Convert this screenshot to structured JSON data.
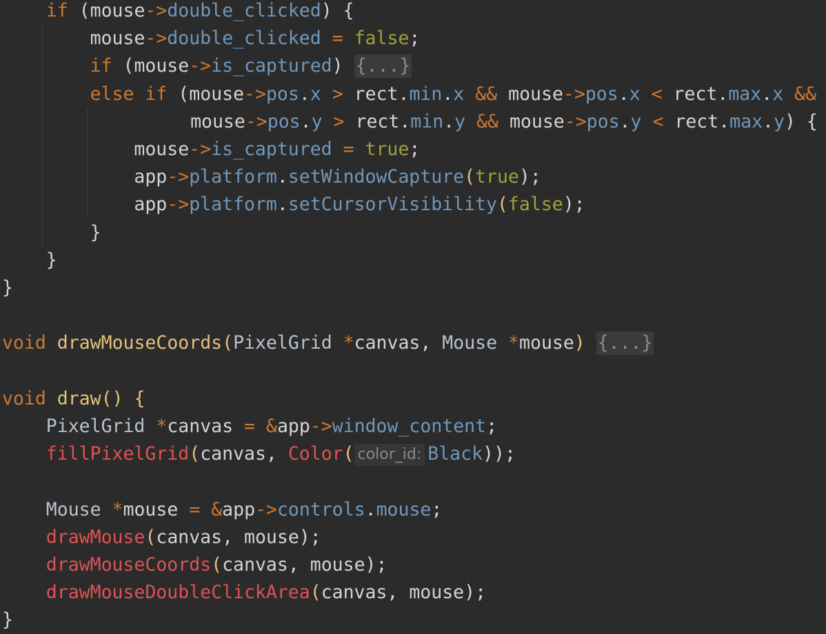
{
  "editor": {
    "colors": {
      "background": "#2b2b2b",
      "keyword": "#cc7832",
      "identifier": "#d4d4d4",
      "field": "#6f98bc",
      "literal": "#a0a03a",
      "method": "#6f98bc",
      "function_decl": "#e6c07b",
      "function_call": "#e05252",
      "type": "#b9c2cc",
      "fold_text": "#8c8c8c",
      "hint_text": "#8a8a8a"
    },
    "lines": [
      {
        "indent": 1,
        "tokens": [
          {
            "t": "if",
            "k": "kw"
          },
          {
            "t": " (",
            "k": "p"
          },
          {
            "t": "mouse",
            "k": "id"
          },
          {
            "t": "->",
            "k": "op"
          },
          {
            "t": "double_clicked",
            "k": "fd"
          },
          {
            "t": ") {",
            "k": "p"
          }
        ]
      },
      {
        "indent": 2,
        "tokens": [
          {
            "t": "mouse",
            "k": "id"
          },
          {
            "t": "->",
            "k": "op"
          },
          {
            "t": "double_clicked",
            "k": "fd"
          },
          {
            "t": " ",
            "k": "p"
          },
          {
            "t": "=",
            "k": "op"
          },
          {
            "t": " ",
            "k": "p"
          },
          {
            "t": "false",
            "k": "lit"
          },
          {
            "t": ";",
            "k": "p"
          }
        ]
      },
      {
        "indent": 2,
        "tokens": [
          {
            "t": "if",
            "k": "kw"
          },
          {
            "t": " (",
            "k": "p"
          },
          {
            "t": "mouse",
            "k": "id"
          },
          {
            "t": "->",
            "k": "op"
          },
          {
            "t": "is_captured",
            "k": "fd"
          },
          {
            "t": ") ",
            "k": "p"
          },
          {
            "t": "{...}",
            "k": "fold"
          }
        ]
      },
      {
        "indent": 2,
        "tokens": [
          {
            "t": "else",
            "k": "kw"
          },
          {
            "t": " ",
            "k": "p"
          },
          {
            "t": "if",
            "k": "kw"
          },
          {
            "t": " (",
            "k": "p"
          },
          {
            "t": "mouse",
            "k": "id"
          },
          {
            "t": "->",
            "k": "op"
          },
          {
            "t": "pos",
            "k": "fd"
          },
          {
            "t": ".",
            "k": "p"
          },
          {
            "t": "x",
            "k": "fd"
          },
          {
            "t": " ",
            "k": "p"
          },
          {
            "t": ">",
            "k": "op"
          },
          {
            "t": " ",
            "k": "p"
          },
          {
            "t": "rect",
            "k": "id"
          },
          {
            "t": ".",
            "k": "p"
          },
          {
            "t": "min",
            "k": "fd"
          },
          {
            "t": ".",
            "k": "p"
          },
          {
            "t": "x",
            "k": "fd"
          },
          {
            "t": " ",
            "k": "p"
          },
          {
            "t": "&&",
            "k": "op"
          },
          {
            "t": " ",
            "k": "p"
          },
          {
            "t": "mouse",
            "k": "id"
          },
          {
            "t": "->",
            "k": "op"
          },
          {
            "t": "pos",
            "k": "fd"
          },
          {
            "t": ".",
            "k": "p"
          },
          {
            "t": "x",
            "k": "fd"
          },
          {
            "t": " ",
            "k": "p"
          },
          {
            "t": "<",
            "k": "op"
          },
          {
            "t": " ",
            "k": "p"
          },
          {
            "t": "rect",
            "k": "id"
          },
          {
            "t": ".",
            "k": "p"
          },
          {
            "t": "max",
            "k": "fd"
          },
          {
            "t": ".",
            "k": "p"
          },
          {
            "t": "x",
            "k": "fd"
          },
          {
            "t": " ",
            "k": "p"
          },
          {
            "t": "&&",
            "k": "op"
          }
        ]
      },
      {
        "indent": 4.28,
        "tokens": [
          {
            "t": "mouse",
            "k": "id"
          },
          {
            "t": "->",
            "k": "op"
          },
          {
            "t": "pos",
            "k": "fd"
          },
          {
            "t": ".",
            "k": "p"
          },
          {
            "t": "y",
            "k": "fd"
          },
          {
            "t": " ",
            "k": "p"
          },
          {
            "t": ">",
            "k": "op"
          },
          {
            "t": " ",
            "k": "p"
          },
          {
            "t": "rect",
            "k": "id"
          },
          {
            "t": ".",
            "k": "p"
          },
          {
            "t": "min",
            "k": "fd"
          },
          {
            "t": ".",
            "k": "p"
          },
          {
            "t": "y",
            "k": "fd"
          },
          {
            "t": " ",
            "k": "p"
          },
          {
            "t": "&&",
            "k": "op"
          },
          {
            "t": " ",
            "k": "p"
          },
          {
            "t": "mouse",
            "k": "id"
          },
          {
            "t": "->",
            "k": "op"
          },
          {
            "t": "pos",
            "k": "fd"
          },
          {
            "t": ".",
            "k": "p"
          },
          {
            "t": "y",
            "k": "fd"
          },
          {
            "t": " ",
            "k": "p"
          },
          {
            "t": "<",
            "k": "op"
          },
          {
            "t": " ",
            "k": "p"
          },
          {
            "t": "rect",
            "k": "id"
          },
          {
            "t": ".",
            "k": "p"
          },
          {
            "t": "max",
            "k": "fd"
          },
          {
            "t": ".",
            "k": "p"
          },
          {
            "t": "y",
            "k": "fd"
          },
          {
            "t": ") {",
            "k": "p"
          }
        ]
      },
      {
        "indent": 3,
        "tokens": [
          {
            "t": "mouse",
            "k": "id"
          },
          {
            "t": "->",
            "k": "op"
          },
          {
            "t": "is_captured",
            "k": "fd"
          },
          {
            "t": " ",
            "k": "p"
          },
          {
            "t": "=",
            "k": "op"
          },
          {
            "t": " ",
            "k": "p"
          },
          {
            "t": "true",
            "k": "lit"
          },
          {
            "t": ";",
            "k": "p"
          }
        ]
      },
      {
        "indent": 3,
        "tokens": [
          {
            "t": "app",
            "k": "id"
          },
          {
            "t": "->",
            "k": "op"
          },
          {
            "t": "platform",
            "k": "fd"
          },
          {
            "t": ".",
            "k": "p"
          },
          {
            "t": "setWindowCapture",
            "k": "mt"
          },
          {
            "t": "(",
            "k": "pp"
          },
          {
            "t": "true",
            "k": "lit"
          },
          {
            "t": ");",
            "k": "p"
          }
        ]
      },
      {
        "indent": 3,
        "tokens": [
          {
            "t": "app",
            "k": "id"
          },
          {
            "t": "->",
            "k": "op"
          },
          {
            "t": "platform",
            "k": "fd"
          },
          {
            "t": ".",
            "k": "p"
          },
          {
            "t": "setCursorVisibility",
            "k": "mt"
          },
          {
            "t": "(",
            "k": "pp"
          },
          {
            "t": "false",
            "k": "lit"
          },
          {
            "t": ");",
            "k": "p"
          }
        ]
      },
      {
        "indent": 2,
        "tokens": [
          {
            "t": "}",
            "k": "p"
          }
        ]
      },
      {
        "indent": 1,
        "tokens": [
          {
            "t": "}",
            "k": "p"
          }
        ]
      },
      {
        "indent": 0,
        "tokens": [
          {
            "t": "}",
            "k": "p"
          }
        ]
      },
      {
        "indent": 0,
        "tokens": []
      },
      {
        "indent": 0,
        "tokens": [
          {
            "t": "void",
            "k": "kw"
          },
          {
            "t": " ",
            "k": "p"
          },
          {
            "t": "drawMouseCoords",
            "k": "fn"
          },
          {
            "t": "(",
            "k": "pp"
          },
          {
            "t": "PixelGrid",
            "k": "ty"
          },
          {
            "t": " ",
            "k": "p"
          },
          {
            "t": "*",
            "k": "op"
          },
          {
            "t": "canvas",
            "k": "id"
          },
          {
            "t": ", ",
            "k": "p"
          },
          {
            "t": "Mouse",
            "k": "ty"
          },
          {
            "t": " ",
            "k": "p"
          },
          {
            "t": "*",
            "k": "op"
          },
          {
            "t": "mouse",
            "k": "id"
          },
          {
            "t": ") ",
            "k": "pp"
          },
          {
            "t": "{...}",
            "k": "fold"
          }
        ]
      },
      {
        "indent": 0,
        "tokens": []
      },
      {
        "indent": 0,
        "tokens": [
          {
            "t": "void",
            "k": "kw"
          },
          {
            "t": " ",
            "k": "p"
          },
          {
            "t": "draw",
            "k": "fn"
          },
          {
            "t": "() {",
            "k": "pp"
          }
        ]
      },
      {
        "indent": 1,
        "tokens": [
          {
            "t": "PixelGrid",
            "k": "ty"
          },
          {
            "t": " ",
            "k": "p"
          },
          {
            "t": "*",
            "k": "op"
          },
          {
            "t": "canvas",
            "k": "id"
          },
          {
            "t": " ",
            "k": "p"
          },
          {
            "t": "=",
            "k": "op"
          },
          {
            "t": " ",
            "k": "p"
          },
          {
            "t": "&",
            "k": "op"
          },
          {
            "t": "app",
            "k": "id"
          },
          {
            "t": "->",
            "k": "op"
          },
          {
            "t": "window_content",
            "k": "fd"
          },
          {
            "t": ";",
            "k": "p"
          }
        ]
      },
      {
        "indent": 1,
        "tokens": [
          {
            "t": "fillPixelGrid",
            "k": "call"
          },
          {
            "t": "(",
            "k": "pp"
          },
          {
            "t": "canvas",
            "k": "id"
          },
          {
            "t": ", ",
            "k": "p"
          },
          {
            "t": "Color",
            "k": "call"
          },
          {
            "t": "(",
            "k": "pp"
          },
          {
            "t": "color_id:",
            "k": "hint"
          },
          {
            "t": "Black",
            "k": "fd"
          },
          {
            "t": "));",
            "k": "p"
          }
        ]
      },
      {
        "indent": 0,
        "tokens": []
      },
      {
        "indent": 1,
        "tokens": [
          {
            "t": "Mouse",
            "k": "ty"
          },
          {
            "t": " ",
            "k": "p"
          },
          {
            "t": "*",
            "k": "op"
          },
          {
            "t": "mouse",
            "k": "id"
          },
          {
            "t": " ",
            "k": "p"
          },
          {
            "t": "=",
            "k": "op"
          },
          {
            "t": " ",
            "k": "p"
          },
          {
            "t": "&",
            "k": "op"
          },
          {
            "t": "app",
            "k": "id"
          },
          {
            "t": "->",
            "k": "op"
          },
          {
            "t": "controls",
            "k": "fd"
          },
          {
            "t": ".",
            "k": "p"
          },
          {
            "t": "mouse",
            "k": "fd"
          },
          {
            "t": ";",
            "k": "p"
          }
        ]
      },
      {
        "indent": 1,
        "tokens": [
          {
            "t": "drawMouse",
            "k": "call"
          },
          {
            "t": "(",
            "k": "pp"
          },
          {
            "t": "canvas",
            "k": "id"
          },
          {
            "t": ", ",
            "k": "p"
          },
          {
            "t": "mouse",
            "k": "id"
          },
          {
            "t": ");",
            "k": "p"
          }
        ]
      },
      {
        "indent": 1,
        "tokens": [
          {
            "t": "drawMouseCoords",
            "k": "call"
          },
          {
            "t": "(",
            "k": "pp"
          },
          {
            "t": "canvas",
            "k": "id"
          },
          {
            "t": ", ",
            "k": "p"
          },
          {
            "t": "mouse",
            "k": "id"
          },
          {
            "t": ");",
            "k": "p"
          }
        ]
      },
      {
        "indent": 1,
        "tokens": [
          {
            "t": "drawMouseDoubleClickArea",
            "k": "call"
          },
          {
            "t": "(",
            "k": "pp"
          },
          {
            "t": "canvas",
            "k": "id"
          },
          {
            "t": ", ",
            "k": "p"
          },
          {
            "t": "mouse",
            "k": "id"
          },
          {
            "t": ");",
            "k": "p"
          }
        ]
      },
      {
        "indent": 0,
        "tokens": [
          {
            "t": "}",
            "k": "p"
          }
        ]
      }
    ]
  }
}
